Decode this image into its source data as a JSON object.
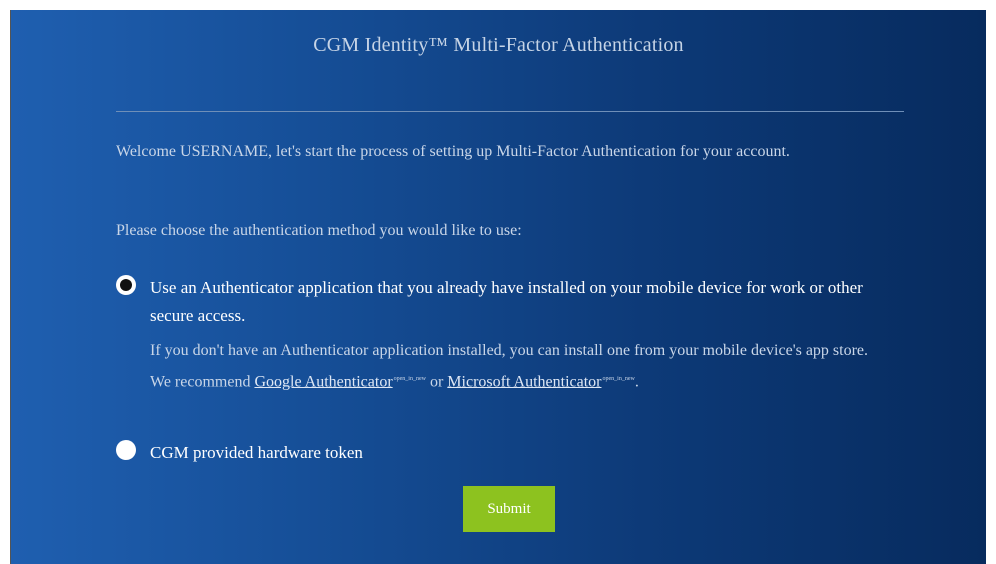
{
  "header": {
    "title": "CGM Identity™ Multi-Factor Authentication"
  },
  "intro": {
    "welcome": "Welcome USERNAME, let's start the process of setting up Multi-Factor Authentication for your account.",
    "choose_prompt": "Please choose the authentication method you would like to use:"
  },
  "options": [
    {
      "label": "Use an Authenticator application that you already have installed on your mobile device for work or other secure access.",
      "selected": true,
      "help_prefix": "If you don't have an Authenticator application installed, you can install one from your mobile device's app store. We recommend ",
      "link1": "Google Authenticator",
      "link1_tag": "open_in_new",
      "help_middle": " or ",
      "link2": "Microsoft Authenticator",
      "link2_tag": "open_in_new",
      "help_suffix": "."
    },
    {
      "label": "CGM provided hardware token",
      "selected": false
    }
  ],
  "submit_label": "Submit",
  "colors": {
    "gradient_start": "#1f5fb0",
    "gradient_end": "#072b5e",
    "submit_bg": "#8dc21f"
  }
}
